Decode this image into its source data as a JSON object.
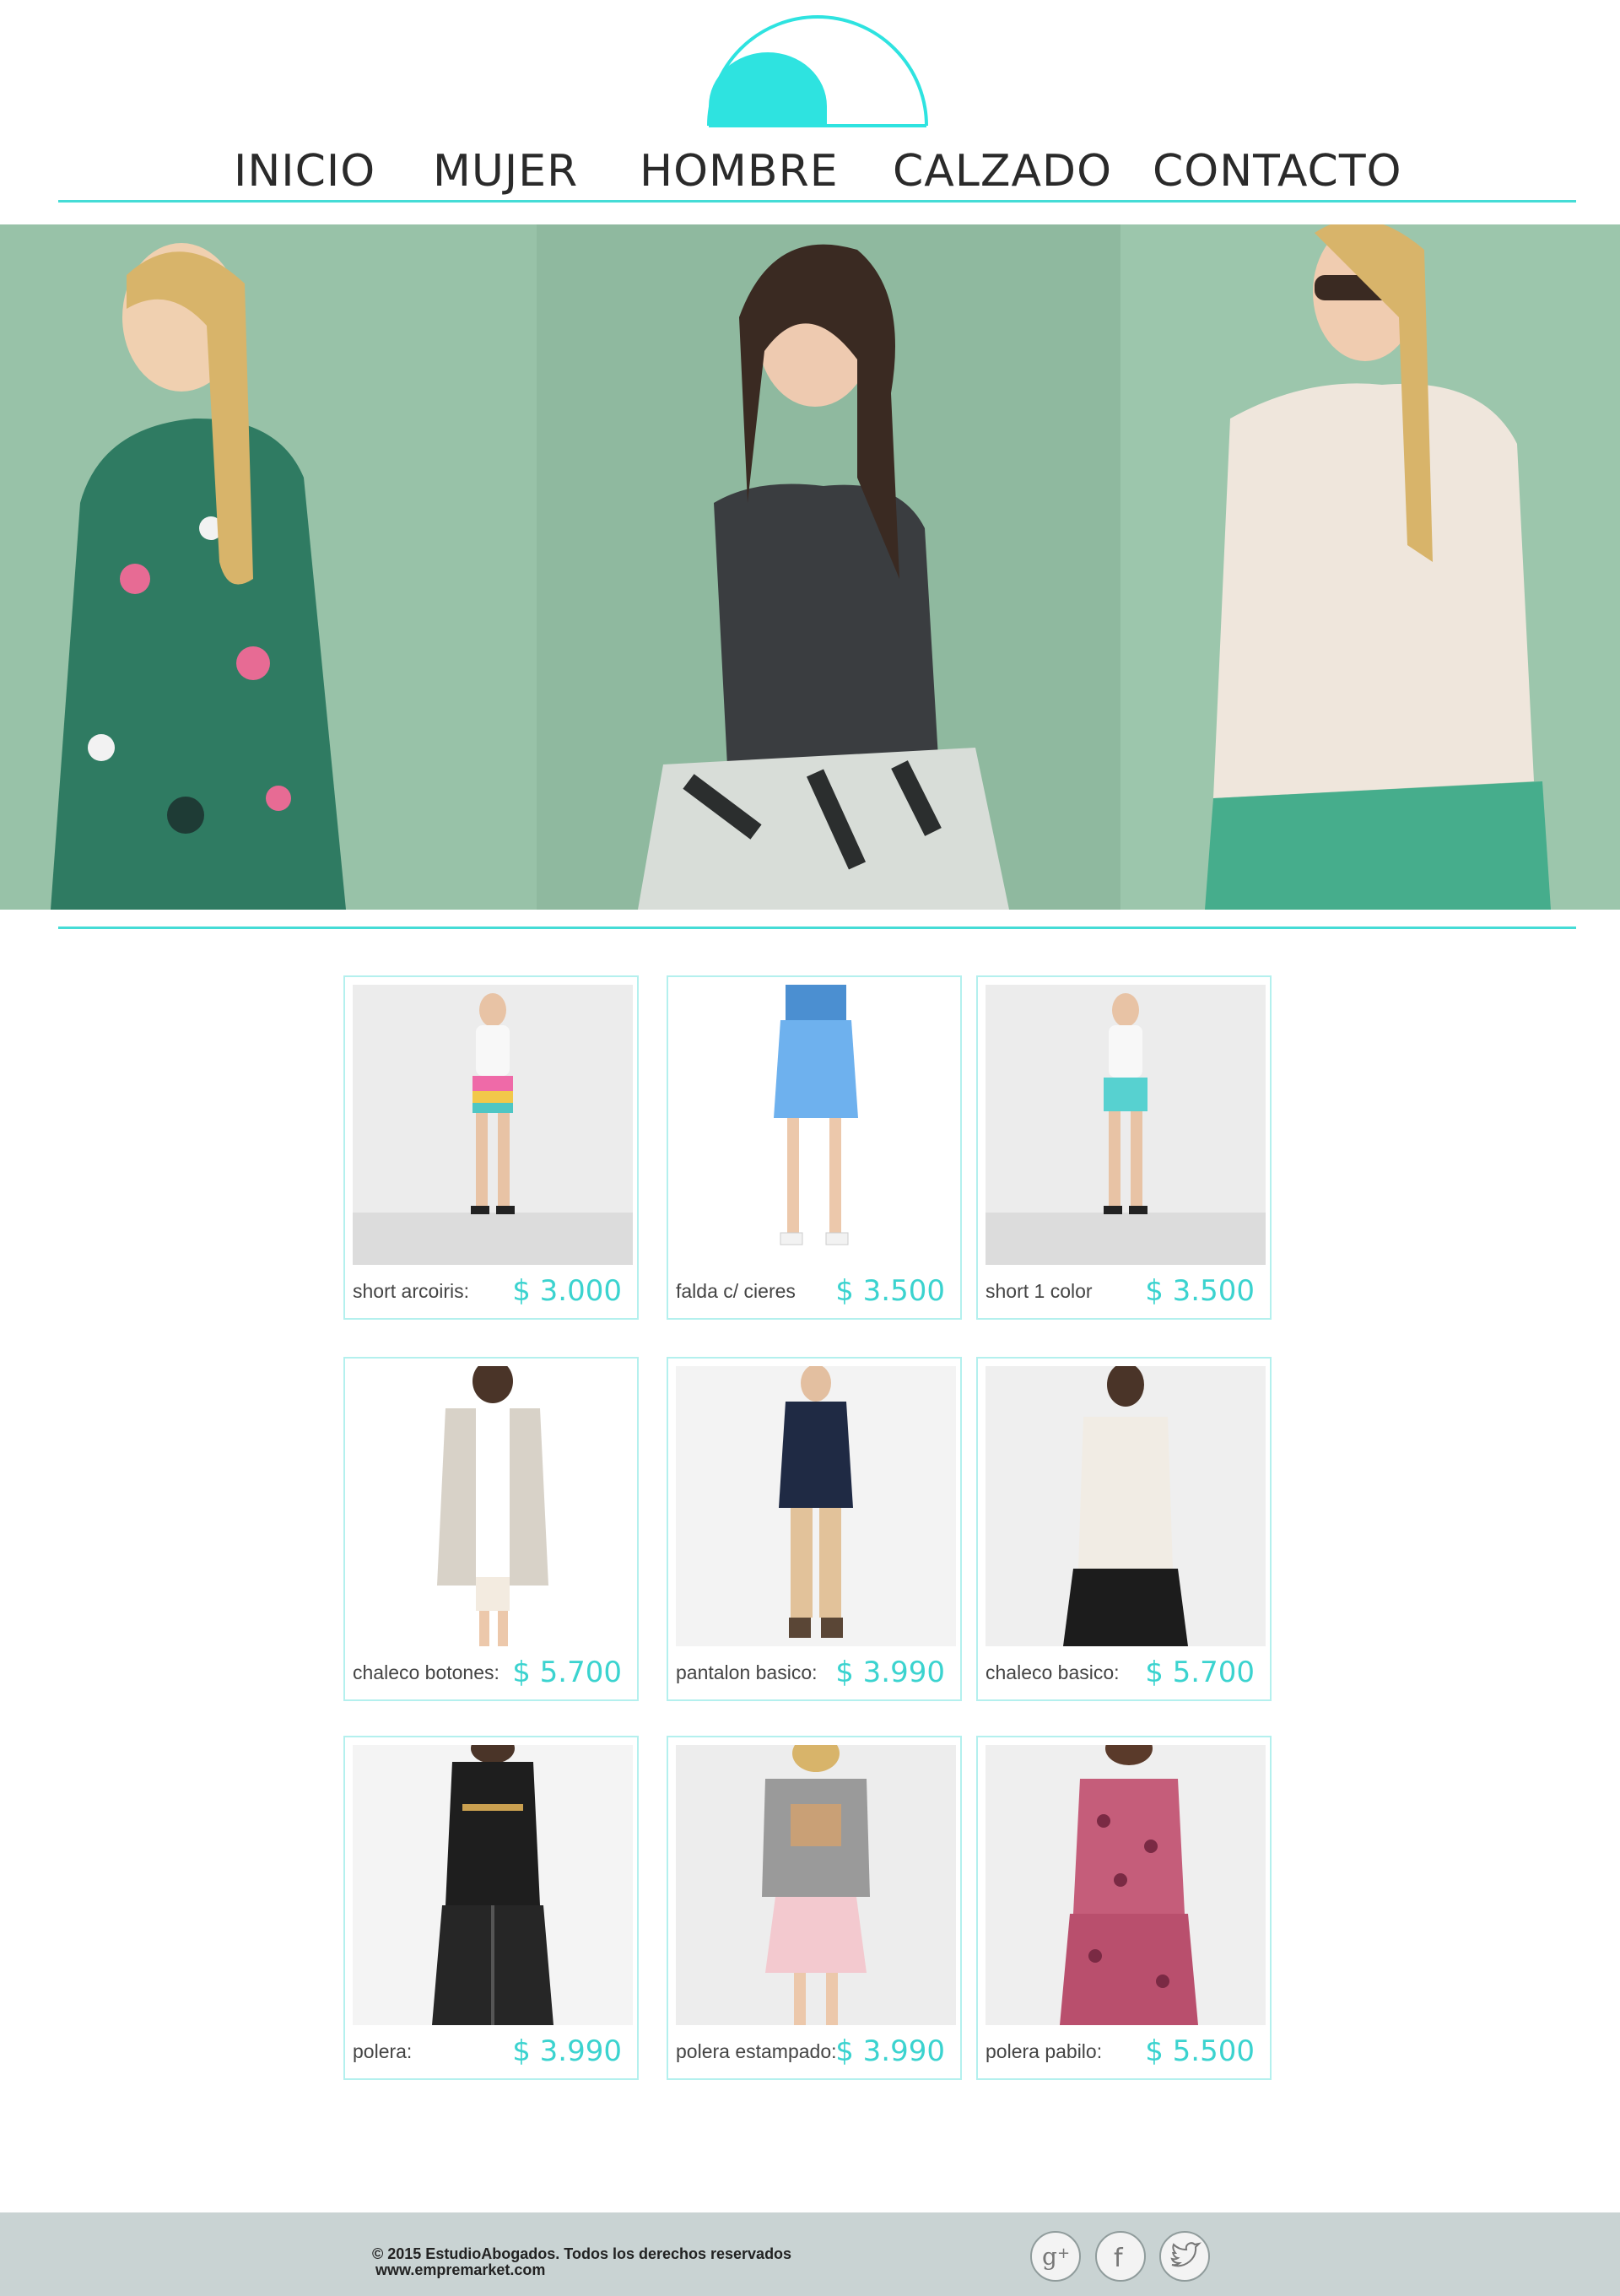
{
  "nav": {
    "items": [
      {
        "label": "INICIO"
      },
      {
        "label": "MUJER"
      },
      {
        "label": "HOMBRE"
      },
      {
        "label": "CALZADO"
      },
      {
        "label": "CONTACTO"
      }
    ]
  },
  "products": [
    {
      "name": "short arcoiris:",
      "price": "$ 3.000"
    },
    {
      "name": "falda c/ cieres",
      "price": "$ 3.500"
    },
    {
      "name": "short 1 color",
      "price": "$ 3.500"
    },
    {
      "name": "chaleco botones:",
      "price": "$ 5.700"
    },
    {
      "name": "pantalon basico:",
      "price": "$ 3.990"
    },
    {
      "name": "chaleco basico:",
      "price": "$ 5.700"
    },
    {
      "name": "polera:",
      "price": "$ 3.990"
    },
    {
      "name": "polera estampado:",
      "price": "$ 3.990"
    },
    {
      "name": "polera pabilo:",
      "price": "$ 5.500"
    }
  ],
  "footer": {
    "copyright": "© 2015  EstudioAbogados. Todos los derechos reservados",
    "website": "www.empremarket.com"
  },
  "colors": {
    "accent": "#45dcd6",
    "logo": "#2ee3e0",
    "footer_bg": "#c9d3d3"
  }
}
